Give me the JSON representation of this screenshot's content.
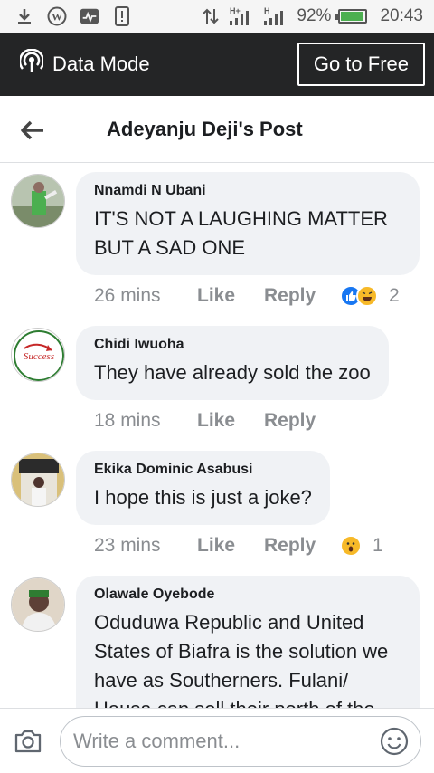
{
  "status_bar": {
    "battery": "92%",
    "time": "20:43",
    "battery_level": 0.92,
    "icons": [
      "download-icon",
      "wordpress-icon",
      "activity-icon",
      "device-icon",
      "data-arrows-icon",
      "signal-icon",
      "signal-icon-2",
      "battery-icon"
    ],
    "network_labels": [
      "H+",
      "H"
    ]
  },
  "data_bar": {
    "label": "Data Mode",
    "button": "Go to Free"
  },
  "header": {
    "title": "Adeyanju Deji's Post"
  },
  "comments": [
    {
      "author": "Nnamdi N Ubani",
      "text": "IT'S NOT A LAUGHING MATTER BUT A SAD ONE",
      "time": "26 mins",
      "like": "Like",
      "reply": "Reply",
      "reactions": [
        "like",
        "haha"
      ],
      "reaction_count": "2"
    },
    {
      "author": "Chidi Iwuoha",
      "text": "They have already sold the zoo",
      "time": "18 mins",
      "like": "Like",
      "reply": "Reply"
    },
    {
      "author": "Ekika Dominic Asabusi",
      "text": "I hope this is just a joke?",
      "time": "23 mins",
      "like": "Like",
      "reply": "Reply",
      "reactions": [
        "wow"
      ],
      "reaction_count": "1"
    },
    {
      "author": "Olawale Oyebode",
      "text": "Oduduwa Republic and United States of Biafra is the solution we have as Southerners. Fulani/ Hausa can sell their north of the country",
      "avatar_badge": "Success"
    }
  ],
  "composer": {
    "placeholder": "Write a comment..."
  },
  "colors": {
    "data_bar": "#242526",
    "bubble": "#f0f2f5",
    "meta_text": "#8a8d91",
    "like_blue": "#1877f2",
    "haha_yellow": "#f7b928"
  }
}
